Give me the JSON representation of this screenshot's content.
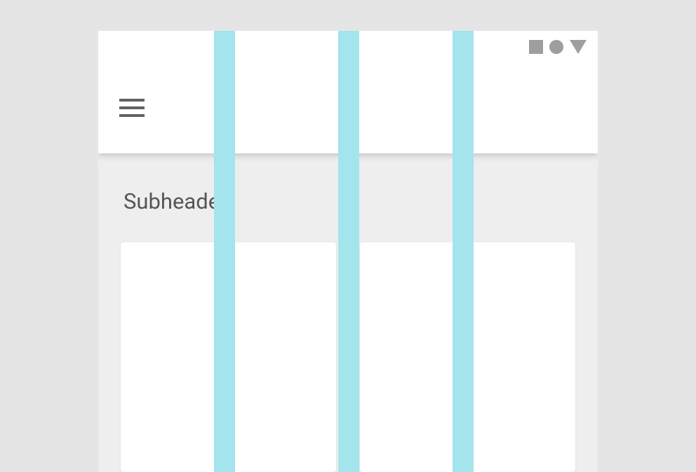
{
  "content": {
    "subheader": "Subheader"
  },
  "guides": {
    "color": "#a3e4ed"
  },
  "status": {
    "icons": [
      "square",
      "circle",
      "triangle"
    ]
  }
}
